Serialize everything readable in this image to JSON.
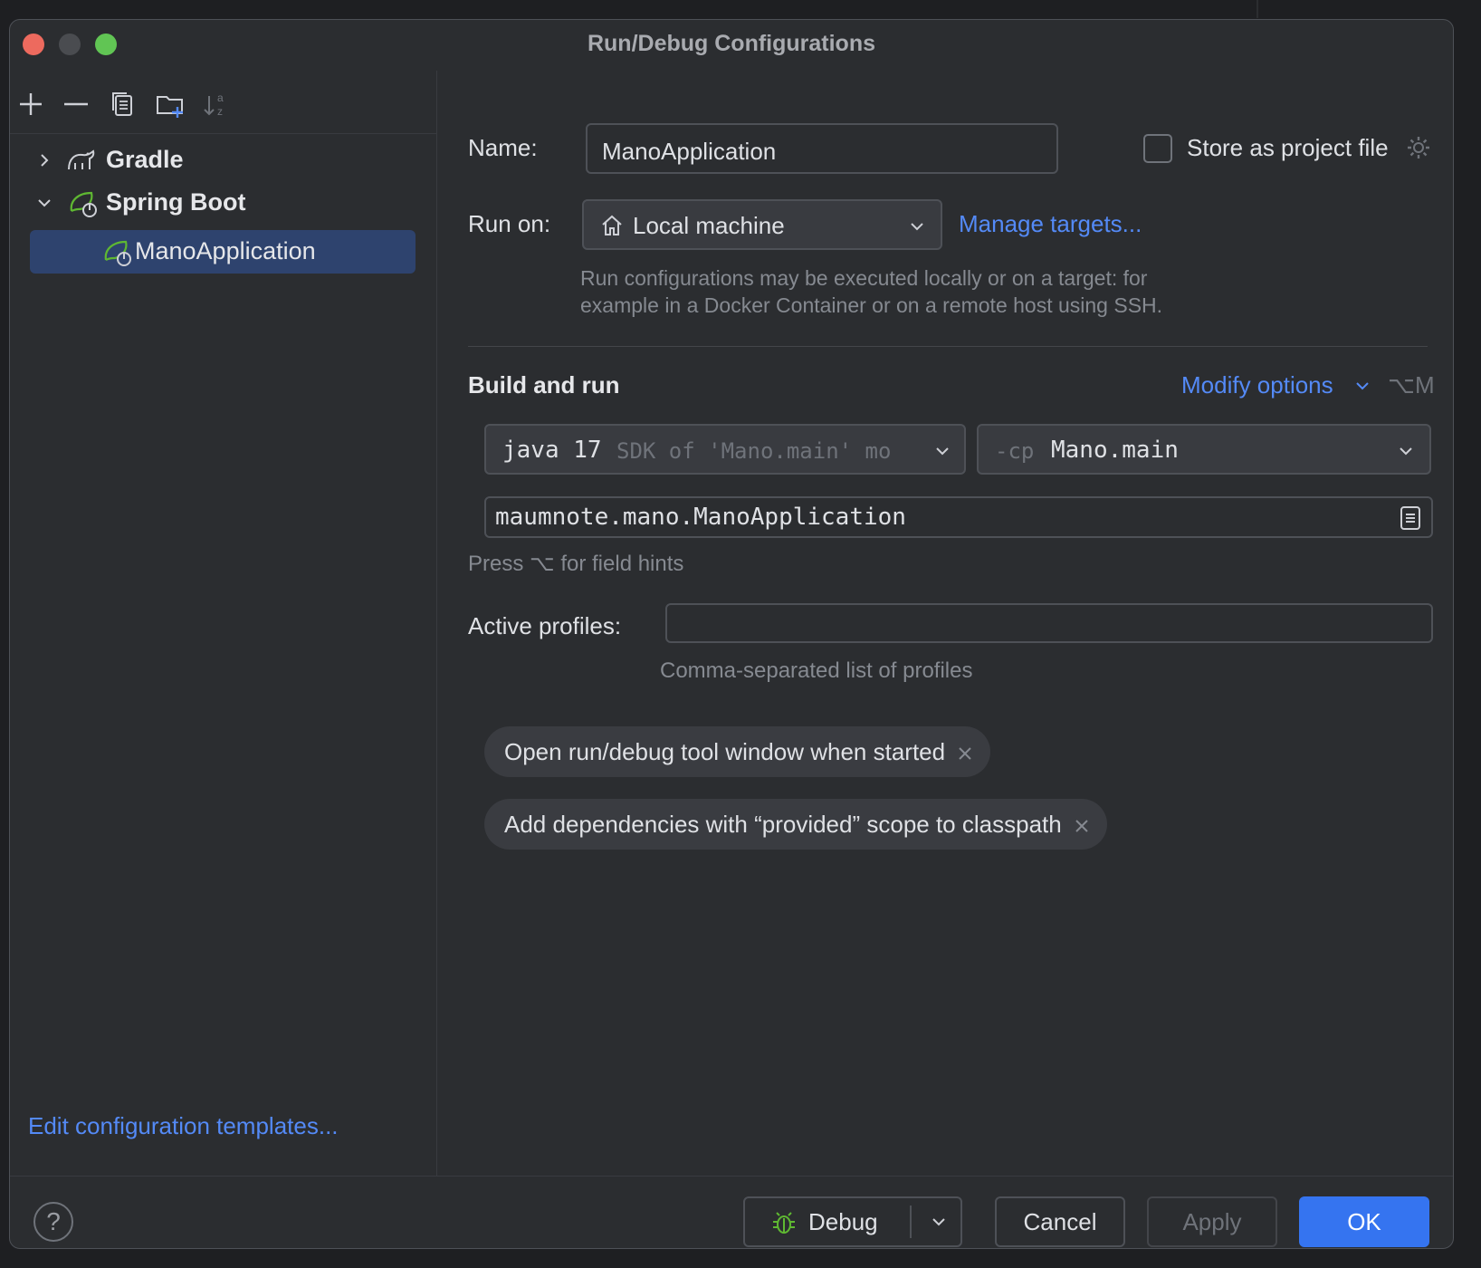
{
  "window": {
    "title": "Run/Debug Configurations"
  },
  "toolbar": {
    "icons": [
      "add-icon",
      "remove-icon",
      "copy-icon",
      "new-folder-icon",
      "sort-icon"
    ]
  },
  "tree": {
    "items": [
      {
        "label": "Gradle",
        "icon": "gradle-icon",
        "expanded": false
      },
      {
        "label": "Spring Boot",
        "icon": "spring-boot-icon",
        "expanded": true
      },
      {
        "label": "ManoApplication",
        "icon": "spring-boot-icon",
        "selected": true
      }
    ]
  },
  "left_footer": {
    "edit_templates": "Edit configuration templates..."
  },
  "form": {
    "name_label": "Name:",
    "name_value": "ManoApplication",
    "store_label": "Store as project file",
    "run_on_label": "Run on:",
    "run_on_value": "Local machine",
    "manage_targets": "Manage targets...",
    "run_on_hint_1": "Run configurations may be executed locally or on a target: for",
    "run_on_hint_2": "example in a Docker Container or on a remote host using SSH.",
    "section_title": "Build and run",
    "modify_options": "Modify options",
    "modify_shortcut": "⌥M",
    "jdk_main": "java 17",
    "jdk_hint": "SDK of 'Mano.main' mo",
    "cp_prefix": "-cp",
    "cp_value": "Mano.main",
    "main_class": "maumnote.mano.ManoApplication",
    "field_hint": "Press ⌥ for field hints",
    "profiles_label": "Active profiles:",
    "profiles_value": "",
    "profiles_hint": "Comma-separated list of profiles",
    "chips": [
      "Open run/debug tool window when started",
      "Add dependencies with “provided” scope to classpath"
    ]
  },
  "buttons": {
    "help": "?",
    "debug": "Debug",
    "cancel": "Cancel",
    "apply": "Apply",
    "ok": "OK"
  },
  "colors": {
    "accent": "#3574f0",
    "link": "#548af7",
    "selection": "#2e436e",
    "background": "#2b2d30"
  }
}
